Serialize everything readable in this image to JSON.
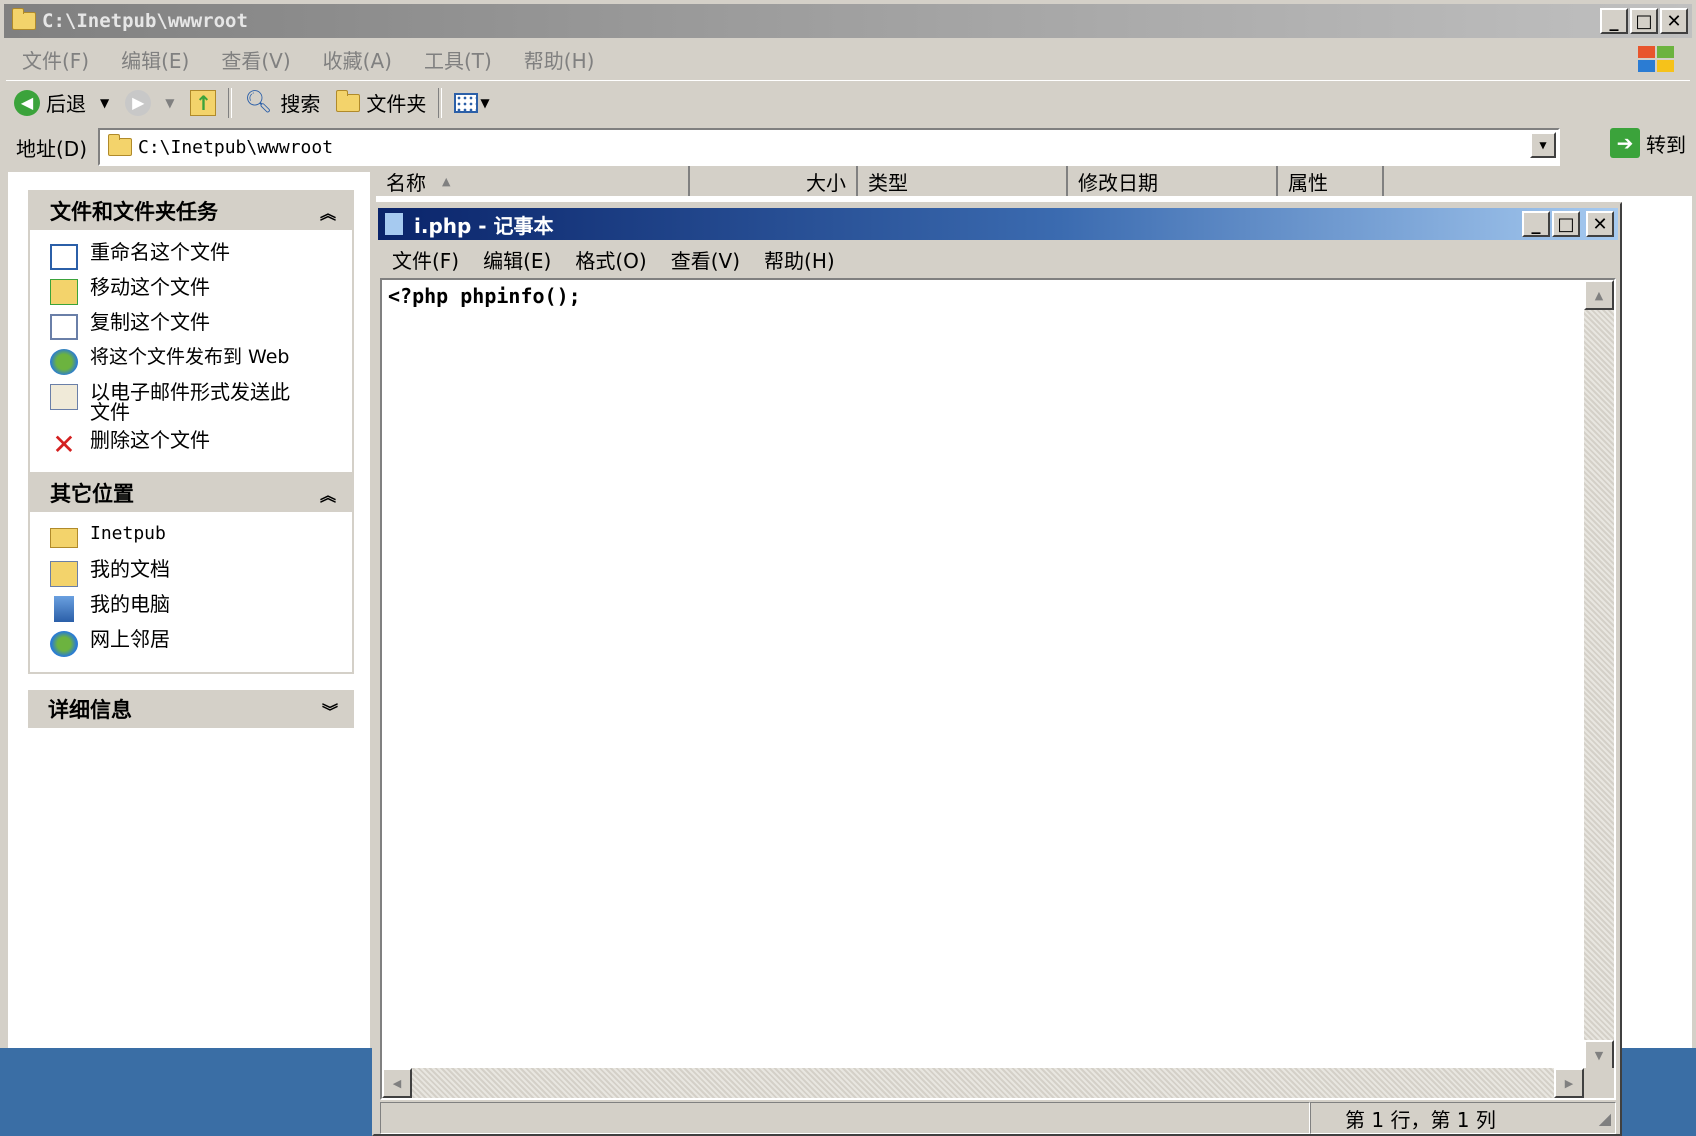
{
  "explorer": {
    "title": "C:\\Inetpub\\wwwroot",
    "menu": [
      "文件(F)",
      "编辑(E)",
      "查看(V)",
      "收藏(A)",
      "工具(T)",
      "帮助(H)"
    ],
    "toolbar": {
      "back": "后退",
      "search": "搜索",
      "folders": "文件夹"
    },
    "address": {
      "label": "地址(D)",
      "value": "C:\\Inetpub\\wwwroot",
      "go": "转到"
    },
    "columns": [
      "名称",
      "大小",
      "类型",
      "修改日期",
      "属性"
    ]
  },
  "left_pane": {
    "tasks": {
      "title": "文件和文件夹任务",
      "items": [
        "重命名这个文件",
        "移动这个文件",
        "复制这个文件",
        "将这个文件发布到 Web",
        "以电子邮件形式发送此文件",
        "删除这个文件"
      ]
    },
    "places": {
      "title": "其它位置",
      "items": [
        "Inetpub",
        "我的文档",
        "我的电脑",
        "网上邻居"
      ]
    },
    "details": {
      "title": "详细信息"
    }
  },
  "notepad": {
    "title": "i.php - 记事本",
    "menu": [
      "文件(F)",
      "编辑(E)",
      "格式(O)",
      "查看(V)",
      "帮助(H)"
    ],
    "content": "<?php phpinfo();",
    "status": "第 1 行，第 1 列"
  },
  "colors": {
    "explorer_title": "#808080",
    "notepad_title": "#0a246a",
    "desktop": "#3a6ea5",
    "chrome": "#d4d0c8"
  }
}
